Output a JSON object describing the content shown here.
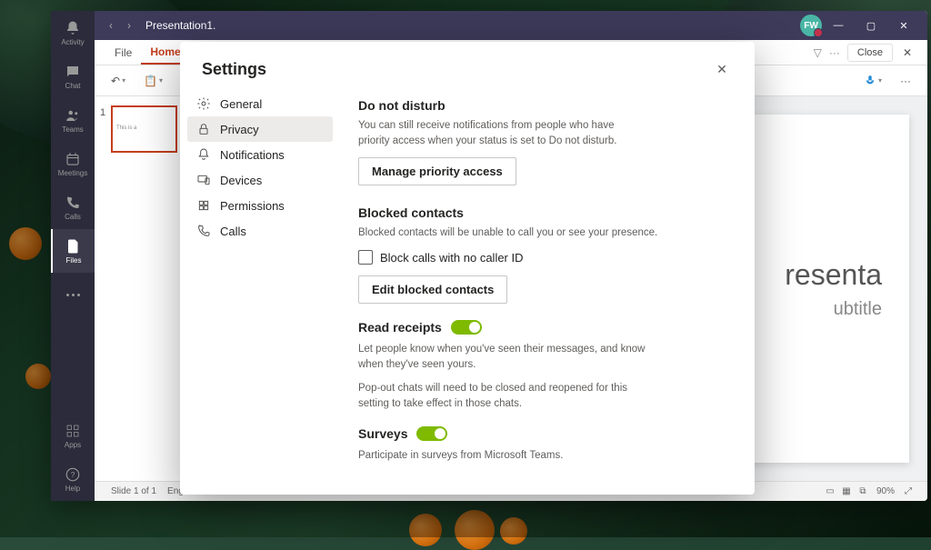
{
  "desktop": {},
  "teams_rail": {
    "items": [
      {
        "label": "Activity"
      },
      {
        "label": "Chat"
      },
      {
        "label": "Teams"
      },
      {
        "label": "Meetings"
      },
      {
        "label": "Calls"
      },
      {
        "label": "Files"
      }
    ],
    "bottom": [
      {
        "label": "Apps"
      },
      {
        "label": "Help"
      }
    ]
  },
  "titlebar": {
    "doc": "Presentation1.",
    "avatar": "FW"
  },
  "ribbon": {
    "tabs": [
      {
        "label": "File"
      },
      {
        "label": "Home"
      }
    ],
    "close_label": "Close"
  },
  "toolbar": {},
  "slide_panel": {
    "num": "1",
    "thumb_text": "This is a"
  },
  "canvas": {
    "title": "resenta",
    "subtitle": "ubtitle"
  },
  "status": {
    "left": "Slide 1 of 1",
    "lang": "Eng",
    "zoom": "90%"
  },
  "settings": {
    "title": "Settings",
    "nav": [
      {
        "label": "General"
      },
      {
        "label": "Privacy"
      },
      {
        "label": "Notifications"
      },
      {
        "label": "Devices"
      },
      {
        "label": "Permissions"
      },
      {
        "label": "Calls"
      }
    ],
    "dnd": {
      "heading": "Do not disturb",
      "desc": "You can still receive notifications from people who have priority access when your status is set to Do not disturb.",
      "button": "Manage priority access"
    },
    "blocked": {
      "heading": "Blocked contacts",
      "desc": "Blocked contacts will be unable to call you or see your presence.",
      "checkbox": "Block calls with no caller ID",
      "button": "Edit blocked contacts"
    },
    "read": {
      "heading": "Read receipts",
      "desc": "Let people know when you've seen their messages, and know when they've seen yours.",
      "desc2": "Pop-out chats will need to be closed and reopened for this setting to take effect in those chats."
    },
    "surveys": {
      "heading": "Surveys",
      "desc": "Participate in surveys from Microsoft Teams."
    }
  }
}
